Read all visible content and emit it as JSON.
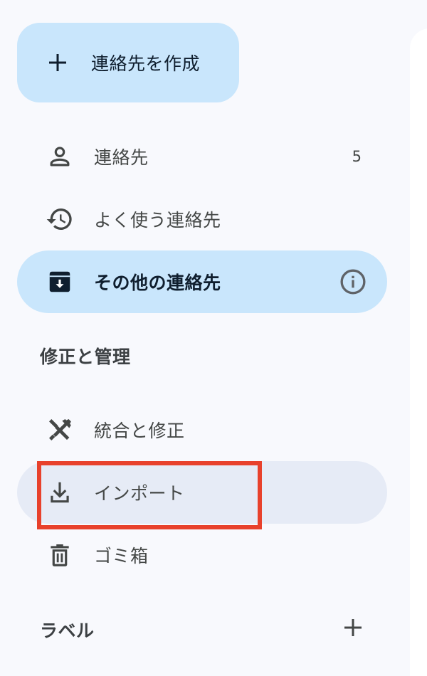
{
  "create_button": {
    "label": "連絡先を作成",
    "icon": "plus-icon"
  },
  "nav": {
    "contacts": {
      "label": "連絡先",
      "count": "5",
      "icon": "person-icon"
    },
    "frequent": {
      "label": "よく使う連絡先",
      "icon": "history-icon"
    },
    "other": {
      "label": "その他の連絡先",
      "icon": "archive-download-icon",
      "info_icon": "info-icon"
    }
  },
  "section_fix_manage": {
    "title": "修正と管理",
    "items": {
      "merge": {
        "label": "統合と修正",
        "icon": "tools-icon"
      },
      "import": {
        "label": "インポート",
        "icon": "download-icon"
      },
      "trash": {
        "label": "ゴミ箱",
        "icon": "trash-icon"
      }
    }
  },
  "labels_section": {
    "title": "ラベル",
    "add_icon": "plus-icon"
  },
  "colors": {
    "selected_bg": "#c9e6fc",
    "hover_bg": "#e6ebf6",
    "highlight": "#e8412c",
    "page_bg": "#f8f9fd"
  }
}
